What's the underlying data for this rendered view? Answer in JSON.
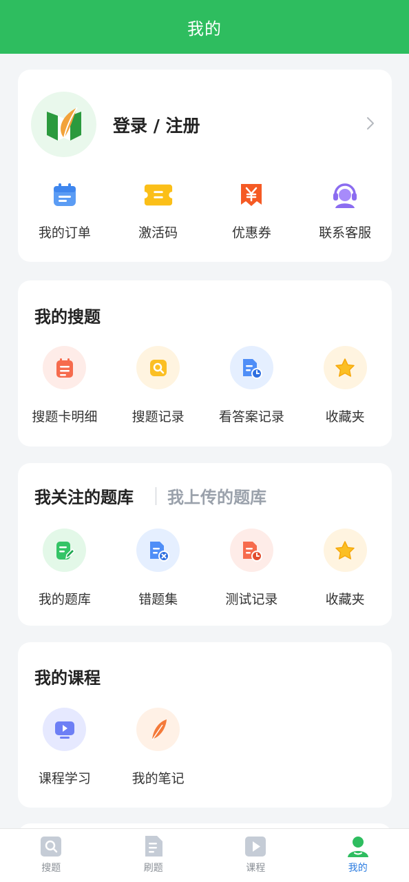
{
  "header": {
    "title": "我的"
  },
  "profile": {
    "login_text": "登录 / 注册"
  },
  "quick_actions": [
    {
      "label": "我的订单",
      "icon": "calendar-icon"
    },
    {
      "label": "激活码",
      "icon": "ticket-icon"
    },
    {
      "label": "优惠券",
      "icon": "coupon-icon"
    },
    {
      "label": "联系客服",
      "icon": "customer-service-icon"
    }
  ],
  "search_section": {
    "title": "我的搜题",
    "items": [
      {
        "label": "搜题卡明细",
        "icon": "notepad-icon"
      },
      {
        "label": "搜题记录",
        "icon": "search-record-icon"
      },
      {
        "label": "看答案记录",
        "icon": "answer-record-icon"
      },
      {
        "label": "收藏夹",
        "icon": "star-icon"
      }
    ]
  },
  "bank_section": {
    "tab_active": "我关注的题库",
    "tab_inactive": "我上传的题库",
    "items": [
      {
        "label": "我的题库",
        "icon": "edit-doc-icon"
      },
      {
        "label": "错题集",
        "icon": "wrong-doc-icon"
      },
      {
        "label": "测试记录",
        "icon": "test-record-icon"
      },
      {
        "label": "收藏夹",
        "icon": "star-icon"
      }
    ]
  },
  "course_section": {
    "title": "我的课程",
    "items": [
      {
        "label": "课程学习",
        "icon": "video-icon"
      },
      {
        "label": "我的笔记",
        "icon": "feather-icon"
      }
    ]
  },
  "tabbar": {
    "items": [
      {
        "label": "搜题",
        "icon": "search-tab-icon"
      },
      {
        "label": "刷题",
        "icon": "doc-tab-icon"
      },
      {
        "label": "课程",
        "icon": "play-tab-icon"
      },
      {
        "label": "我的",
        "icon": "user-tab-icon"
      }
    ],
    "active": "我的"
  },
  "colors": {
    "brand_green": "#2ebd5f",
    "active_tab": "#2a7be0",
    "background": "#f3f5f7"
  }
}
